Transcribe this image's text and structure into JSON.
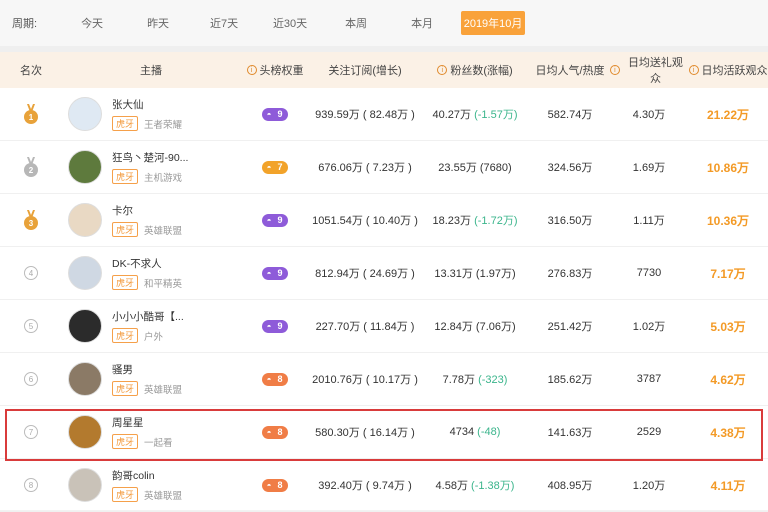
{
  "filters": {
    "label": "周期:",
    "options": [
      "今天",
      "昨天",
      "近7天",
      "近30天",
      "本周",
      "本月"
    ],
    "active": "2019年10月"
  },
  "columns": {
    "rank": "名次",
    "anchor": "主播",
    "weight": "头榜权重",
    "subs": "关注订阅(增长)",
    "fans": "粉丝数(涨幅)",
    "pop": "日均人气/热度",
    "gift": "日均送礼观众",
    "active": "日均活跃观众"
  },
  "rows": [
    {
      "rank": "1",
      "name": "张大仙",
      "platform": "虎牙",
      "category": "王者荣耀",
      "weight": "9",
      "weight_color": "purple",
      "subs": "939.59万 ( 82.48万 )",
      "fans_main": "40.27万",
      "fans_delta": "(-1.57万)",
      "pop": "582.74万",
      "gift": "4.30万",
      "active": "21.22万"
    },
    {
      "rank": "2",
      "name": "狂鸟丶楚河-90...",
      "platform": "虎牙",
      "category": "主机游戏",
      "weight": "7",
      "weight_color": "orange",
      "subs": "676.06万 ( 7.23万 )",
      "fans_main": "23.55万 (7680)",
      "fans_delta": "",
      "pop": "324.56万",
      "gift": "1.69万",
      "active": "10.86万"
    },
    {
      "rank": "3",
      "name": "卡尔",
      "platform": "虎牙",
      "category": "英雄联盟",
      "weight": "9",
      "weight_color": "purple",
      "subs": "1051.54万 ( 10.40万 )",
      "fans_main": "18.23万",
      "fans_delta": "(-1.72万)",
      "pop": "316.50万",
      "gift": "1.11万",
      "active": "10.36万"
    },
    {
      "rank": "4",
      "name": "DK-不求人",
      "platform": "虎牙",
      "category": "和平精英",
      "weight": "9",
      "weight_color": "purple",
      "subs": "812.94万 ( 24.69万 )",
      "fans_main": "13.31万 (1.97万)",
      "fans_delta": "",
      "pop": "276.83万",
      "gift": "7730",
      "active": "7.17万"
    },
    {
      "rank": "5",
      "name": "小小小酷哥【...",
      "platform": "虎牙",
      "category": "户外",
      "weight": "9",
      "weight_color": "purple",
      "subs": "227.70万 ( 11.84万 )",
      "fans_main": "12.84万 (7.06万)",
      "fans_delta": "",
      "pop": "251.42万",
      "gift": "1.02万",
      "active": "5.03万"
    },
    {
      "rank": "6",
      "name": "骚男",
      "platform": "虎牙",
      "category": "英雄联盟",
      "weight": "8",
      "weight_color": "red",
      "subs": "2010.76万 ( 10.17万 )",
      "fans_main": "7.78万",
      "fans_delta": "(-323)",
      "pop": "185.62万",
      "gift": "3787",
      "active": "4.62万"
    },
    {
      "rank": "7",
      "name": "周星星",
      "platform": "虎牙",
      "category": "一起看",
      "weight": "8",
      "weight_color": "red",
      "subs": "580.30万 ( 16.14万 )",
      "fans_main": "4734",
      "fans_delta": "(-48)",
      "pop": "141.63万",
      "gift": "2529",
      "active": "4.38万"
    },
    {
      "rank": "8",
      "name": "韵哥colin",
      "platform": "虎牙",
      "category": "英雄联盟",
      "weight": "8",
      "weight_color": "red",
      "subs": "392.40万 ( 9.74万 )",
      "fans_main": "4.58万",
      "fans_delta": "(-1.38万)",
      "pop": "408.95万",
      "gift": "1.20万",
      "active": "4.11万"
    }
  ],
  "colors": {
    "accent": "#f9a23a",
    "gold": "#e8a23a",
    "silver": "#b7b7b7",
    "highlight": "#d93b3b",
    "negative": "#3bb58c"
  }
}
